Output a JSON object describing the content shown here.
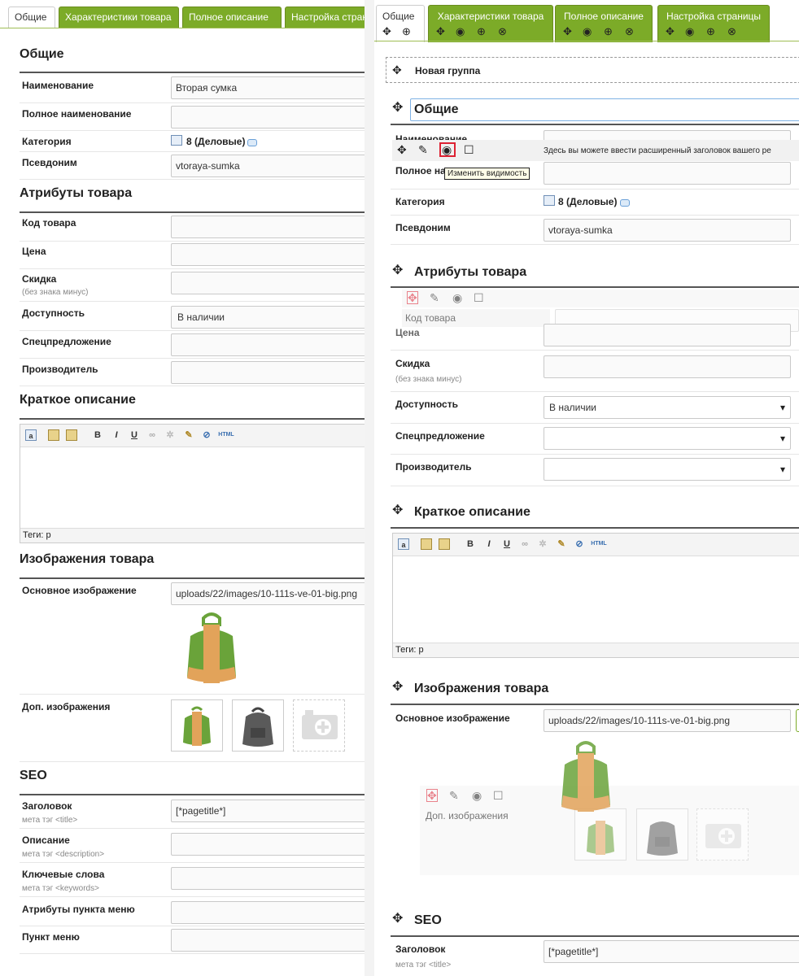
{
  "left": {
    "tabs": [
      "Общие",
      "Характеристики товара",
      "Полное описание",
      "Настройка страницы"
    ],
    "general": {
      "title": "Общие",
      "name_label": "Наименование",
      "name_value": "Вторая сумка",
      "fullname_label": "Полное наименование",
      "category_label": "Категория",
      "category_value": "8 (Деловые)",
      "alias_label": "Псевдоним",
      "alias_value": "vtoraya-sumka"
    },
    "attrs": {
      "title": "Атрибуты товара",
      "code_label": "Код товара",
      "price_label": "Цена",
      "discount_label": "Скидка",
      "discount_hint": "(без знака минус)",
      "avail_label": "Доступность",
      "avail_value": "В наличии",
      "special_label": "Спецпредложение",
      "maker_label": "Производитель"
    },
    "short": {
      "title": "Краткое описание",
      "tags": "Теги: p"
    },
    "images": {
      "title": "Изображения товара",
      "main_label": "Основное изображение",
      "main_value": "uploads/22/images/10-111s-ve-01-big.png",
      "extra_label": "Доп. изображения"
    },
    "seo": {
      "title": "SEO",
      "header_label": "Заголовок",
      "header_hint": "мета тэг <title>",
      "header_value": "[*pagetitle*]",
      "desc_label": "Описание",
      "desc_hint": "мета тэг <description>",
      "kw_label": "Ключевые слова",
      "kw_hint": "мета тэг <keywords>",
      "menuattr_label": "Атрибуты пункта меню",
      "menu_label": "Пункт меню"
    }
  },
  "right": {
    "tabs": [
      "Общие",
      "Характеристики товара",
      "Полное описание",
      "Настройка страницы"
    ],
    "new_group": "Новая группа",
    "general_title": "Общие",
    "name_label": "Наименование",
    "tooltip_long": "Здесь вы можете ввести расширенный заголовок вашего ре",
    "fullname_label": "Полное наименование",
    "visibility_tooltip": "Изменить видимость",
    "category_label": "Категория",
    "category_value": "8 (Деловые)",
    "alias_label": "Псевдоним",
    "alias_value": "vtoraya-sumka",
    "attrs_title": "Атрибуты товара",
    "code_label": "Код товара",
    "price_label": "Цена",
    "discount_label": "Скидка",
    "discount_hint": "(без знака минус)",
    "avail_label": "Доступность",
    "avail_value": "В наличии",
    "special_label": "Спецпредложение",
    "maker_label": "Производитель",
    "short_title": "Краткое описание",
    "tags": "Теги: p",
    "images_title": "Изображения товара",
    "main_label": "Основное изображение",
    "main_value": "uploads/22/images/10-111s-ve-01-big.png",
    "extra_label": "Доп. изображения",
    "seo_title": "SEO",
    "header_label": "Заголовок",
    "header_hint": "мета тэг <title>",
    "header_value": "[*pagetitle*]"
  },
  "editor_toolbar": [
    "B",
    "I",
    "U",
    "HTML"
  ],
  "colors": {
    "tab_green": "#7cab28",
    "section_line": "#555555",
    "focus_blue": "#7fb2e5"
  },
  "icons": [
    "move-icon",
    "add-icon",
    "eye-icon",
    "close-icon",
    "pencil-icon",
    "edit-icon",
    "comment-icon",
    "window-icon"
  ]
}
